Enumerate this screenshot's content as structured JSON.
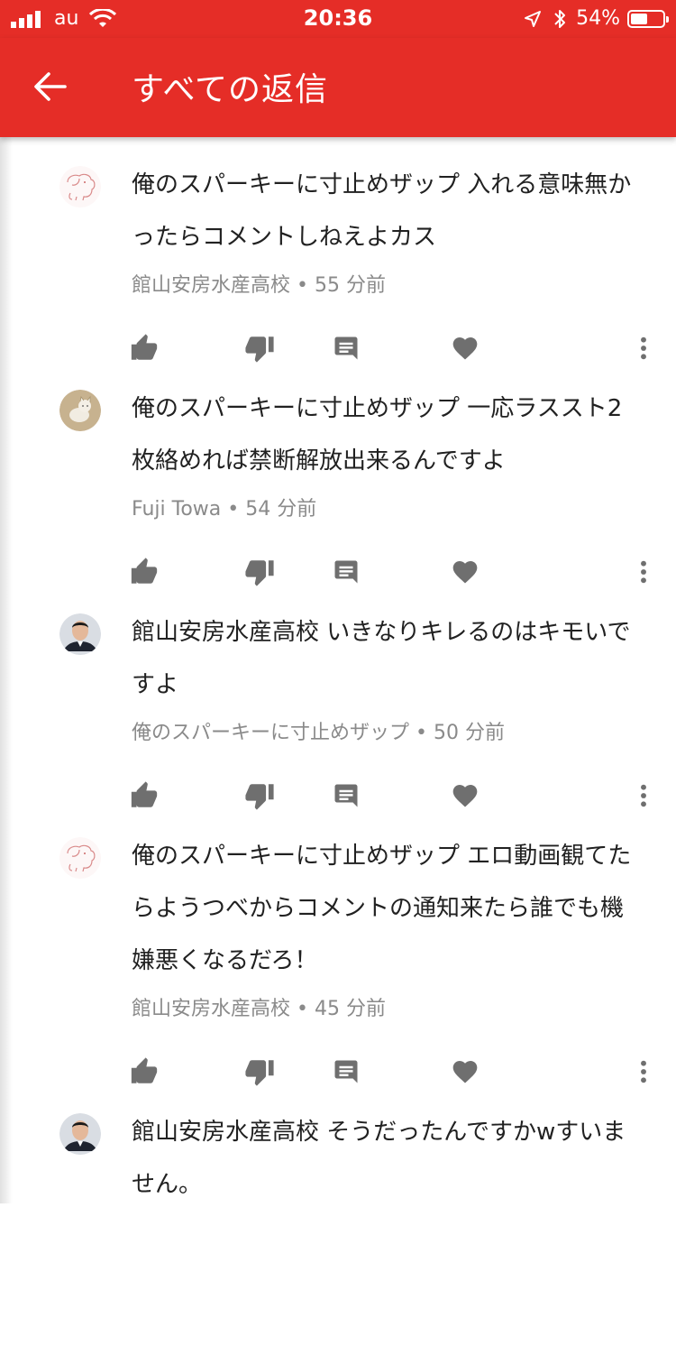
{
  "status_bar": {
    "carrier": "au",
    "time": "20:36",
    "battery": "54%",
    "battery_level": 0.54
  },
  "header": {
    "title": "すべての返信",
    "back_icon": "arrow-back-icon",
    "background": "#e52d27"
  },
  "comments": [
    {
      "text": "俺のスパーキーに寸止めザップ 入れる意味無かったらコメントしねえよカス",
      "author": "館山安房水産高校",
      "time": "55 分前",
      "avatar": "elephant-sketch-avatar"
    },
    {
      "text": "俺のスパーキーに寸止めザップ 一応ラススト2枚絡めれば禁断解放出来るんですよ",
      "author": "Fuji Towa",
      "time": "54 分前",
      "avatar": "cat-photo-avatar"
    },
    {
      "text": "館山安房水産高校 いきなりキレるのはキモいですよ",
      "author": "俺のスパーキーに寸止めザップ",
      "time": "50 分前",
      "avatar": "man-photo-avatar"
    },
    {
      "text": "俺のスパーキーに寸止めザップ エロ動画観てたらようつべからコメントの通知来たら誰でも機嫌悪くなるだろ！",
      "author": "館山安房水産高校",
      "time": "45 分前",
      "avatar": "elephant-sketch-avatar"
    },
    {
      "text": "館山安房水産高校 そうだったんですかwすいません。",
      "author": "",
      "time": "",
      "avatar": "man-photo-avatar"
    }
  ],
  "action_icons": [
    "thumb-up-icon",
    "thumb-down-icon",
    "reply-icon",
    "heart-icon",
    "more-vert-icon"
  ],
  "separator": " • "
}
